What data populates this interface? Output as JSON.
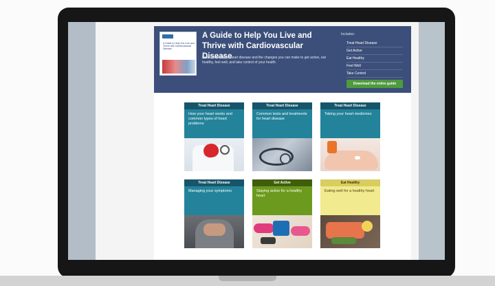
{
  "hero": {
    "title": "A Guide to Help You Live and Thrive with Cardiovascular Disease",
    "description": "Learn more about heart disease and the changes you can make to get active, eat healthy, feel well, and take control of your health.",
    "thumbnail_title": "A Guide to Help You Live and Thrive with Cardiovascular Disease",
    "includes_heading": "Includes:",
    "includes": [
      "Treat Heart Disease",
      "Get Active",
      "Eat Healthy",
      "Feel Well",
      "Take Control"
    ],
    "download_label": "Download the entire guide"
  },
  "cards": [
    {
      "category": "Treat Heart Disease",
      "title": "How your heart works and common types of heart problems",
      "image": "heart-model-photo"
    },
    {
      "category": "Treat Heart Disease",
      "title": "Common tests and treatments for heart disease",
      "image": "stethoscope-photo"
    },
    {
      "category": "Treat Heart Disease",
      "title": "Taking your heart medicines",
      "image": "pills-in-hand-photo"
    },
    {
      "category": "Treat Heart Disease",
      "title": "Managing your symptoms",
      "image": "hands-on-chest-photo"
    },
    {
      "category": "Get Active",
      "title": "Staying active for a healthy heart",
      "image": "exercise-gear-photo"
    },
    {
      "category": "Eat Healthy",
      "title": "Eating well for a healthy heart",
      "image": "salmon-meal-photo"
    }
  ],
  "colors": {
    "hero_bg": "#3c4f7a",
    "teal": "#23839a",
    "green": "#6c9a1e",
    "yellow": "#f1ea8e",
    "download_button": "#4f9a3d"
  }
}
